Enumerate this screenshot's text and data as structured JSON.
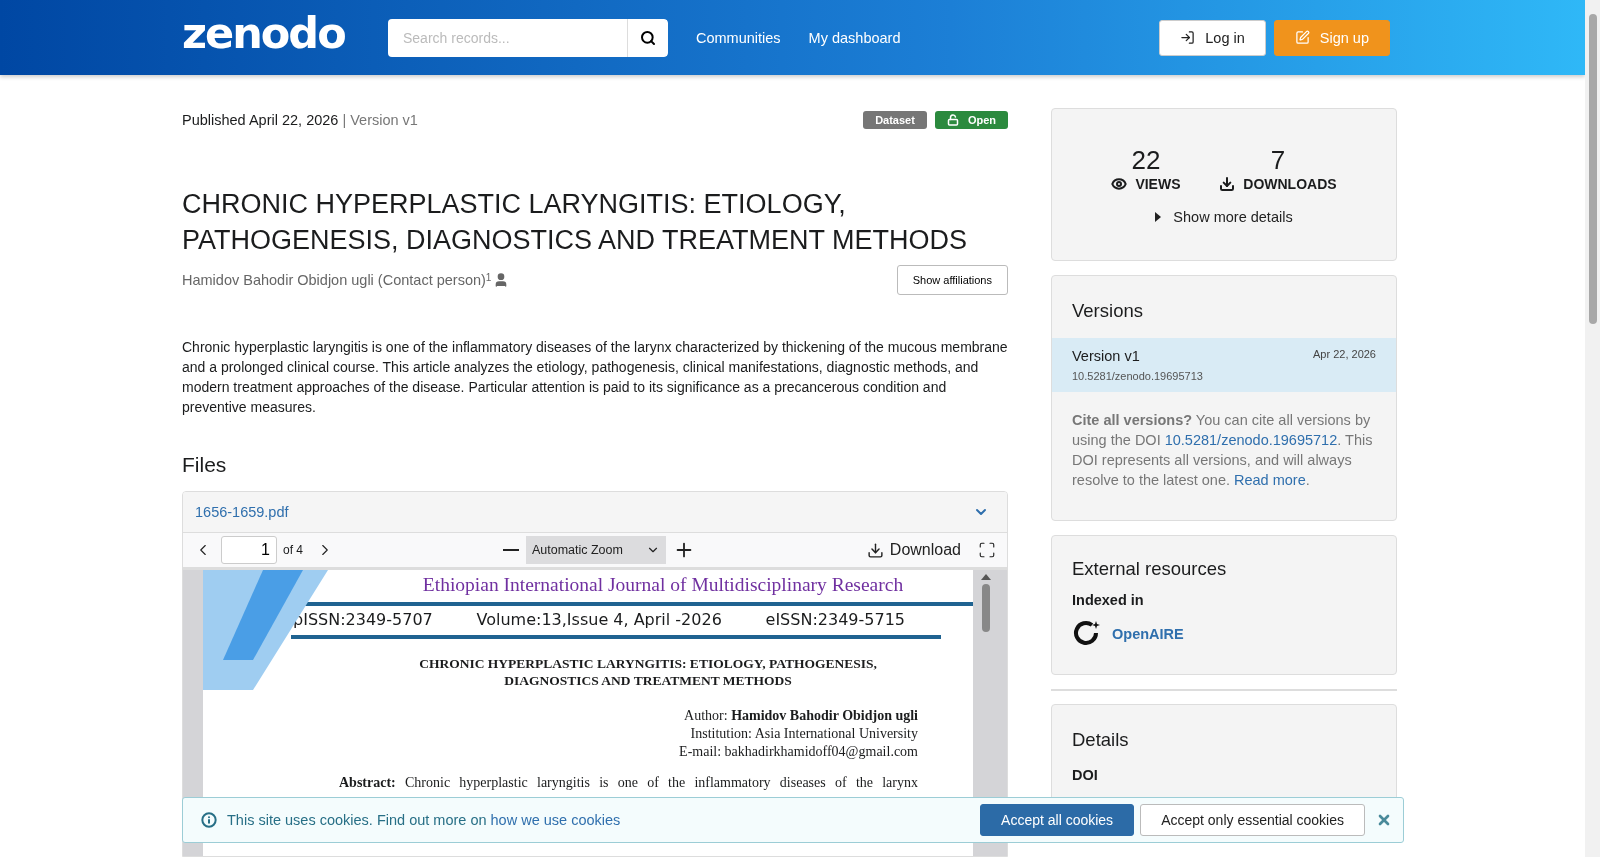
{
  "header": {
    "logo": "zenodo",
    "search": {
      "placeholder": "Search records..."
    },
    "nav": [
      "Communities",
      "My dashboard"
    ],
    "login": "Log in",
    "signup": "Sign up"
  },
  "record": {
    "published": "Published April 22, 2026",
    "version": "| Version v1",
    "badges": [
      {
        "label": "Dataset",
        "kind": "type"
      },
      {
        "label": "Open",
        "kind": "access"
      }
    ],
    "title": "CHRONIC HYPERPLASTIC LARYNGITIS: ETIOLOGY, PATHOGENESIS, DIAGNOSTICS AND TREATMENT METHODS",
    "authors": [
      {
        "name": "Hamidov Bahodir Obidjon ugli (Contact person)",
        "affiliation_mark": "1",
        "contact": true
      }
    ],
    "affiliations_button": "Show affiliations",
    "description": " Chronic hyperplastic laryngitis is one of the inflammatory diseases of the larynx characterized by thickening of the mucous membrane and a prolonged clinical course. This article analyzes the etiology, pathogenesis, clinical manifestations, diagnostic methods, and modern treatment approaches of the disease. Particular attention is paid to its significance as a precancerous condition and preventive measures."
  },
  "files": {
    "heading": "Files",
    "file_name": "1656-1659.pdf",
    "viewer": {
      "page": "1",
      "page_count": "of 4",
      "zoom": "Automatic Zoom",
      "download": "Download",
      "document": {
        "journal": "Ethiopian International Journal of Multidisciplinary Research",
        "issn_print": "pISSN:2349-5707",
        "volume": "Volume:13,Issue 4, April -2026",
        "issn_e": "eISSN:2349-5715",
        "title_lines": [
          "CHRONIC HYPERPLASTIC LARYNGITIS: ETIOLOGY, PATHOGENESIS,",
          "DIAGNOSTICS AND TREATMENT METHODS"
        ],
        "meta_lines": [
          "Author: **Hamidov Bahodir Obidjon ugli**",
          "Institution: Asia International University",
          "E-mail: bakhadirkhamidoff04@gmail.com"
        ],
        "abstract": "**Abstract:** Chronic hyperplastic laryngitis is one of the inflammatory diseases of the larynx"
      }
    }
  },
  "sidebar": {
    "stats": [
      {
        "value": "22",
        "label": "VIEWS",
        "kind": "views"
      },
      {
        "value": "7",
        "label": "DOWNLOADS",
        "kind": "downloads"
      }
    ],
    "show_more": "Show more details",
    "versions": {
      "heading": "Versions",
      "items": [
        {
          "label": "Version v1",
          "date": "Apr 22, 2026",
          "doi": "10.5281/zenodo.19695713",
          "selected": true
        }
      ],
      "cite_lead": "Cite all versions?",
      "cite_text": " You can cite all versions by using the DOI ",
      "cite_doi": "10.5281/zenodo.19695712",
      "cite_text_2": ". This DOI represents all versions, and will always resolve to the latest one. ",
      "read_more": "Read more",
      "cite_end": "."
    },
    "external": {
      "heading": "External resources",
      "subheading": "Indexed in",
      "items": [
        "OpenAIRE"
      ]
    },
    "details": {
      "heading": "Details",
      "fields": [
        "DOI"
      ]
    }
  },
  "cookies": {
    "text": "This site uses cookies. Find out more on ",
    "link": "how we use cookies",
    "accept_all": "Accept all cookies",
    "accept_essential": "Accept only essential cookies"
  }
}
